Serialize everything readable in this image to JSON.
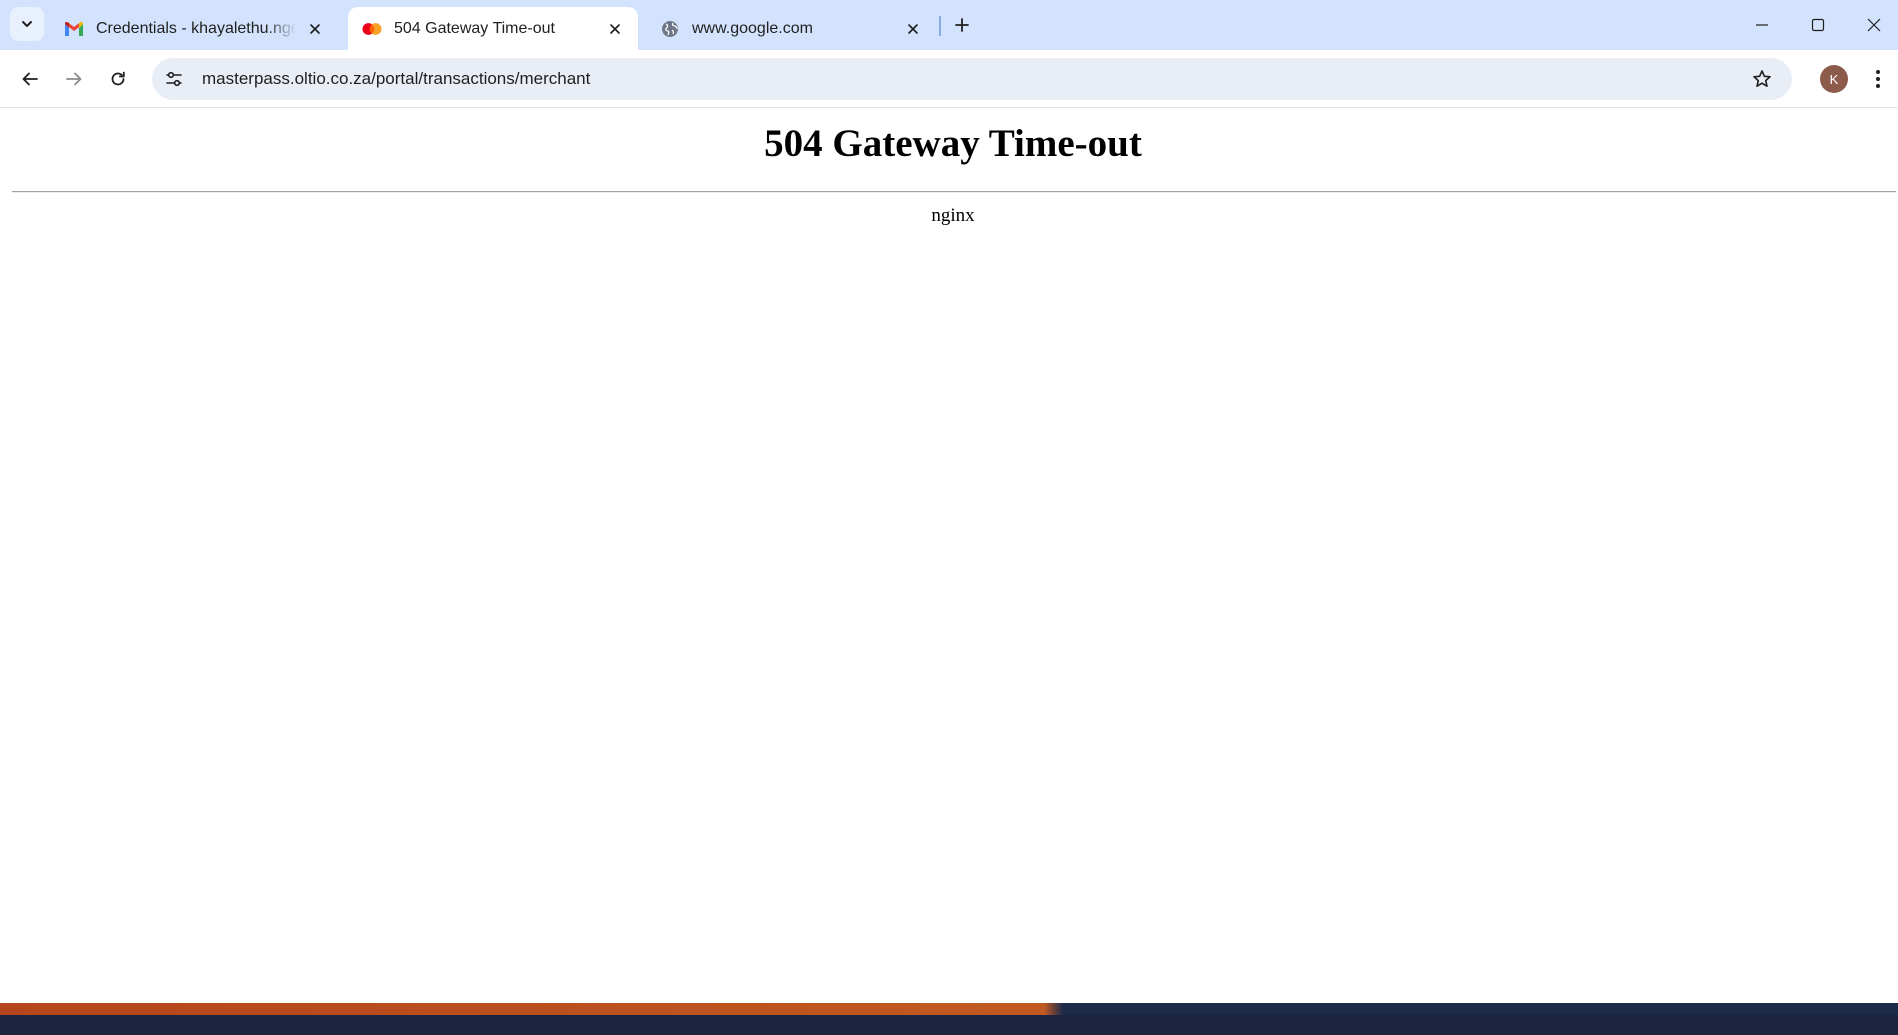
{
  "browser": {
    "tabs": [
      {
        "title": "Credentials - khayalethu.ngema",
        "favicon": "gmail-icon",
        "active": false
      },
      {
        "title": "504 Gateway Time-out",
        "favicon": "mastercard-icon",
        "active": true
      },
      {
        "title": "www.google.com",
        "favicon": "globe-icon",
        "active": false
      }
    ],
    "address": {
      "url": "masterpass.oltio.co.za/portal/transactions/merchant"
    },
    "profile_initial": "K",
    "colors": {
      "tabstrip": "#d3e3fd",
      "omnibox": "#e9eef6",
      "avatar": "#8d5b4c"
    }
  },
  "page": {
    "heading": "504 Gateway Time-out",
    "server": "nginx"
  }
}
